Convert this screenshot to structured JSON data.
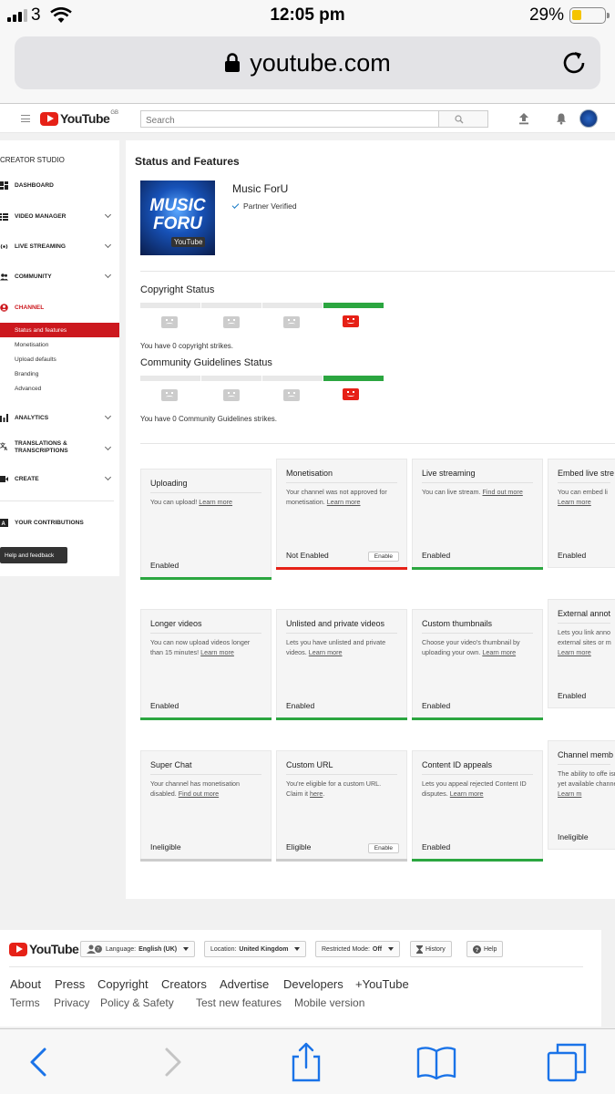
{
  "status_bar": {
    "carrier": "3",
    "time": "12:05 pm",
    "battery": "29%",
    "battery_level": 0.29
  },
  "browser": {
    "url": "youtube.com"
  },
  "header": {
    "logo_text": "YouTube",
    "region": "GB",
    "search_placeholder": "Search"
  },
  "sidebar": {
    "title": "CREATOR STUDIO",
    "items": [
      {
        "label": "DASHBOARD"
      },
      {
        "label": "VIDEO MANAGER"
      },
      {
        "label": "LIVE STREAMING"
      },
      {
        "label": "COMMUNITY"
      },
      {
        "label": "CHANNEL"
      }
    ],
    "sub_items": [
      "Status and features",
      "Monetisation",
      "Upload defaults",
      "Branding",
      "Advanced"
    ],
    "items2": [
      {
        "label": "ANALYTICS"
      },
      {
        "label": "TRANSLATIONS &",
        "label2": "TRANSCRIPTIONS"
      },
      {
        "label": "CREATE"
      },
      {
        "label": "YOUR CONTRIBUTIONS"
      }
    ],
    "help": "Help and feedback"
  },
  "main": {
    "title": "Status and Features",
    "channel": {
      "name": "Music ForU",
      "badge": "Partner Verified",
      "thumb_line1": "MUSIC",
      "thumb_line2": "FORU",
      "thumb_line3": "YouTube"
    },
    "copyright": {
      "title": "Copyright Status",
      "text": "You have 0 copyright strikes."
    },
    "guidelines": {
      "title": "Community Guidelines Status",
      "text": "You have 0 Community Guidelines strikes."
    },
    "cards": [
      {
        "title": "Uploading",
        "desc": "You can upload!",
        "link": "Learn more",
        "status": "Enabled"
      },
      {
        "title": "Monetisation",
        "desc": "Your channel was not approved for monetisation.",
        "link": "Learn more",
        "status": "Not Enabled",
        "button": "Enable"
      },
      {
        "title": "Live streaming",
        "desc": "You can live stream.",
        "link": "Find out more",
        "status": "Enabled"
      },
      {
        "title": "Embed live stre",
        "desc": "You can embed li",
        "link": "Learn more",
        "status": "Enabled"
      },
      {
        "title": "Longer videos",
        "desc": "You can now upload videos longer than 15 minutes!",
        "link": "Learn more",
        "status": "Enabled"
      },
      {
        "title": "Unlisted and private videos",
        "desc": "Lets you have unlisted and private videos.",
        "link": "Learn more",
        "status": "Enabled"
      },
      {
        "title": "Custom thumbnails",
        "desc": "Choose your video's thumbnail by uploading your own.",
        "link": "Learn more",
        "status": "Enabled"
      },
      {
        "title": "External annot",
        "desc": "Lets you link anno external sites or m",
        "link": "Learn more",
        "status": "Enabled"
      },
      {
        "title": "Super Chat",
        "desc": "Your channel has monetisation disabled.",
        "link": "Find out more",
        "status": "Ineligible"
      },
      {
        "title": "Custom URL",
        "desc": "You're eligible for a custom URL. Claim it",
        "link": "here",
        "status": "Eligible",
        "button": "Enable"
      },
      {
        "title": "Content ID appeals",
        "desc": "Lets you appeal rejected Content ID disputes.",
        "link": "Learn more",
        "status": "Enabled"
      },
      {
        "title": "Channel memb",
        "desc": "The ability to offe isn't yet available channel.",
        "link": "Learn m",
        "status": "Ineligible"
      }
    ]
  },
  "footer": {
    "language_label": "Language:",
    "language_value": "English (UK)",
    "location_label": "Location:",
    "location_value": "United Kingdom",
    "restricted_label": "Restricted Mode:",
    "restricted_value": "Off",
    "history": "History",
    "help": "Help",
    "links": [
      "About",
      "Press",
      "Copyright",
      "Creators",
      "Advertise",
      "Developers",
      "+YouTube"
    ],
    "links2": [
      "Terms",
      "Privacy",
      "Policy & Safety",
      "Test new features",
      "Mobile version"
    ]
  }
}
